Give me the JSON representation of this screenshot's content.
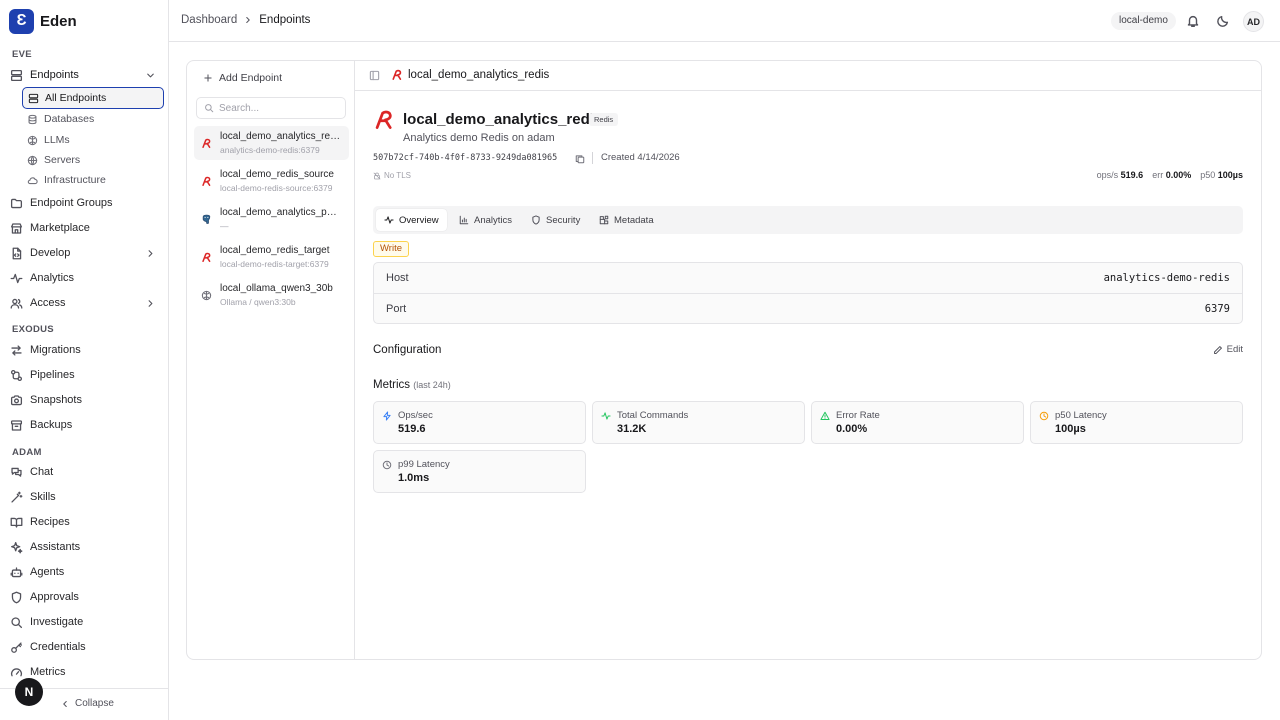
{
  "app": {
    "name": "Eden",
    "logo_letter": "Ɛ"
  },
  "sidebar": {
    "sections": [
      {
        "label": "EVE"
      },
      {
        "label": "EXODUS"
      },
      {
        "label": "ADAM"
      }
    ],
    "endpoints": {
      "label": "Endpoints"
    },
    "endpoint_subitems": [
      {
        "label": "All Endpoints"
      },
      {
        "label": "Databases"
      },
      {
        "label": "LLMs"
      },
      {
        "label": "Servers"
      },
      {
        "label": "Infrastructure"
      }
    ],
    "eve_items": [
      {
        "label": "Endpoint Groups"
      },
      {
        "label": "Marketplace"
      },
      {
        "label": "Develop"
      },
      {
        "label": "Analytics"
      },
      {
        "label": "Access"
      }
    ],
    "exodus_items": [
      {
        "label": "Migrations"
      },
      {
        "label": "Pipelines"
      },
      {
        "label": "Snapshots"
      },
      {
        "label": "Backups"
      }
    ],
    "adam_items": [
      {
        "label": "Chat"
      },
      {
        "label": "Skills"
      },
      {
        "label": "Recipes"
      },
      {
        "label": "Assistants"
      },
      {
        "label": "Agents"
      },
      {
        "label": "Approvals"
      },
      {
        "label": "Investigate"
      },
      {
        "label": "Credentials"
      },
      {
        "label": "Metrics"
      }
    ],
    "collapse_label": "Collapse",
    "next_badge": "N"
  },
  "topbar": {
    "breadcrumb": [
      "Dashboard",
      "Endpoints"
    ],
    "env_badge": "local-demo",
    "avatar": "AD"
  },
  "list": {
    "add_label": "Add Endpoint",
    "search_placeholder": "Search...",
    "items": [
      {
        "name": "local_demo_analytics_redis",
        "sub": "analytics-demo-redis:6379",
        "type": "redis"
      },
      {
        "name": "local_demo_redis_source",
        "sub": "local-demo-redis-source:6379",
        "type": "redis"
      },
      {
        "name": "local_demo_analytics_postgres",
        "sub": "—",
        "type": "postgres"
      },
      {
        "name": "local_demo_redis_target",
        "sub": "local-demo-redis-target:6379",
        "type": "redis"
      },
      {
        "name": "local_ollama_qwen3_30b",
        "sub": "Ollama / qwen3:30b",
        "type": "llm"
      }
    ]
  },
  "detail": {
    "header_title": "local_demo_analytics_redis",
    "name": "local_demo_analytics_redis",
    "type_badge": "Redis",
    "description": "Analytics demo Redis on adam",
    "uuid": "507b72cf-740b-4f0f-8733-9249da081965",
    "created": "Created 4/14/2026",
    "tls": "No TLS",
    "stats": {
      "ops_label": "ops/s",
      "ops": "519.6",
      "err_label": "err",
      "err": "0.00%",
      "p50_label": "p50",
      "p50": "100µs"
    },
    "tabs": [
      {
        "label": "Overview"
      },
      {
        "label": "Analytics"
      },
      {
        "label": "Security"
      },
      {
        "label": "Metadata"
      }
    ],
    "access_badge": "Write",
    "connection": [
      {
        "key": "Host",
        "value": "analytics-demo-redis"
      },
      {
        "key": "Port",
        "value": "6379"
      }
    ],
    "configuration_title": "Configuration",
    "edit_label": "Edit",
    "metrics_title": "Metrics",
    "metrics_period": "(last 24h)",
    "metrics": [
      {
        "label": "Ops/sec",
        "value": "519.6",
        "icon": "zap-icon",
        "color": "#3b82f6"
      },
      {
        "label": "Total Commands",
        "value": "31.2K",
        "icon": "activity-icon",
        "color": "#22c55e"
      },
      {
        "label": "Error Rate",
        "value": "0.00%",
        "icon": "alert-triangle-icon",
        "color": "#22c55e"
      },
      {
        "label": "p50 Latency",
        "value": "100µs",
        "icon": "clock-icon",
        "color": "#f59e0b"
      },
      {
        "label": "p99 Latency",
        "value": "1.0ms",
        "icon": "clock-icon",
        "color": "#71717a"
      }
    ]
  },
  "colors": {
    "accent": "#1e40af",
    "redis": "#dc2626",
    "write_badge": "#b45309"
  }
}
